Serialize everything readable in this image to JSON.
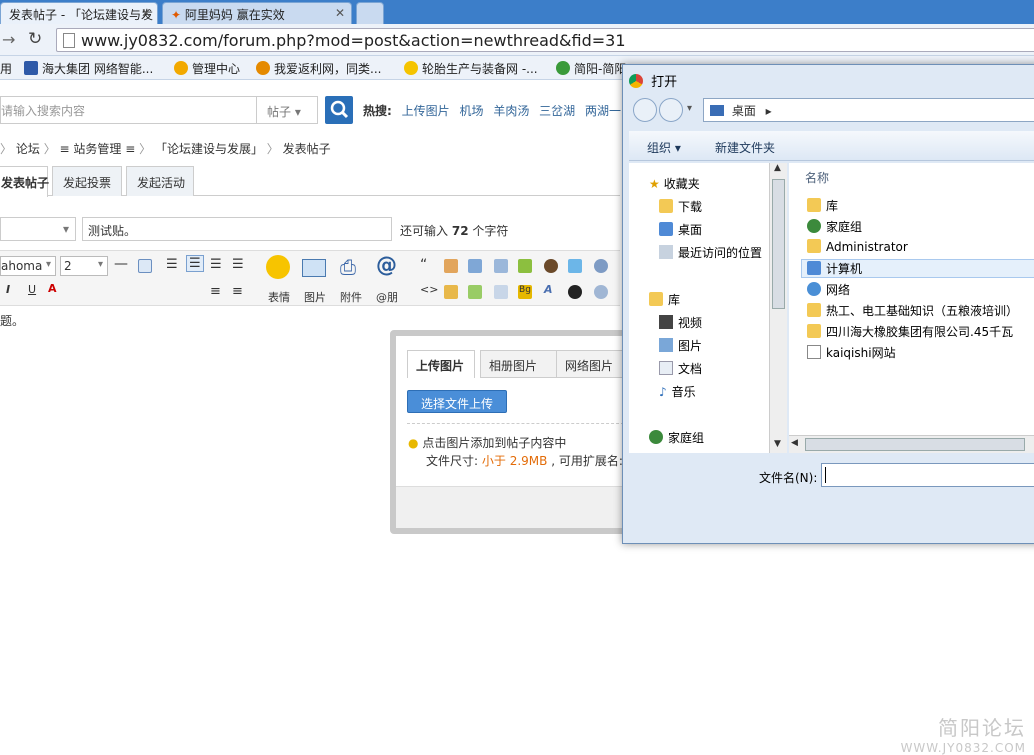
{
  "browser": {
    "tabs": [
      {
        "label": "发表帖子 - 「论坛建设与发"
      },
      {
        "label": "阿里妈妈 赢在实效"
      },
      {
        "label": ""
      }
    ],
    "url": "www.jy0832.com/forum.php?mod=post&action=newthread&fid=31",
    "bookmarks": [
      {
        "label": "用"
      },
      {
        "label": "海大集团 网络智能..."
      },
      {
        "label": "管理中心"
      },
      {
        "label": "我爱返利网，同类..."
      },
      {
        "label": "轮胎生产与装备网 -..."
      },
      {
        "label": "简阳-简阳"
      }
    ]
  },
  "forum": {
    "search_placeholder": "请输入搜索内容",
    "search_type": "帖子",
    "hot_label": "热搜:",
    "hot_terms": [
      "上传图片",
      "机场",
      "羊肉汤",
      "三岔湖",
      "两湖一山"
    ],
    "breadcrumb": [
      "论坛",
      "≡ 站务管理 ≡",
      "「论坛建设与发展」",
      "发表帖子"
    ],
    "post_tabs": [
      "发表帖子",
      "发起投票",
      "发起活动"
    ],
    "subject_type": "",
    "subject_value": "测试贴。",
    "remaining_prefix": "还可输入",
    "remaining_count": "72",
    "remaining_suffix": "个字符",
    "editor": {
      "font": "ahoma",
      "size": "2",
      "buttons": {
        "emoji": "表情",
        "image": "图片",
        "attach": "附件",
        "at": "@朋"
      }
    },
    "content_text": "题。"
  },
  "upload_dialog": {
    "tabs": [
      "上传图片",
      "相册图片",
      "网络图片"
    ],
    "button": "选择文件上传",
    "hint": "点击图片添加到帖子内容中",
    "size_prefix": "文件尺寸:",
    "size_limit": "小于 2.9MB",
    "size_suffix": ", 可用扩展名:"
  },
  "file_dialog": {
    "title": "打开",
    "location": "桌面",
    "organize": "组织",
    "new_folder": "新建文件夹",
    "nav": [
      {
        "label": "收藏夹"
      },
      {
        "label": "下载"
      },
      {
        "label": "桌面"
      },
      {
        "label": "最近访问的位置"
      },
      {
        "label": "库"
      },
      {
        "label": "视频"
      },
      {
        "label": "图片"
      },
      {
        "label": "文档"
      },
      {
        "label": "音乐"
      },
      {
        "label": "家庭组"
      }
    ],
    "column_name": "名称",
    "files": [
      {
        "label": "库"
      },
      {
        "label": "家庭组"
      },
      {
        "label": "Administrator"
      },
      {
        "label": "计算机"
      },
      {
        "label": "网络"
      },
      {
        "label": "热工、电工基础知识（五粮液培训）"
      },
      {
        "label": "四川海大橡胶集团有限公司.45千瓦"
      },
      {
        "label": "kaiqishi网站"
      }
    ],
    "filename_label": "文件名(N):",
    "filename_value": ""
  },
  "watermark": {
    "line1": "简阳论坛",
    "line2": "WWW.JY0832.COM"
  },
  "colors": {
    "accent": "#2a6fb8",
    "tabstrip": "#3c7ec9",
    "warn": "#e36c09"
  }
}
